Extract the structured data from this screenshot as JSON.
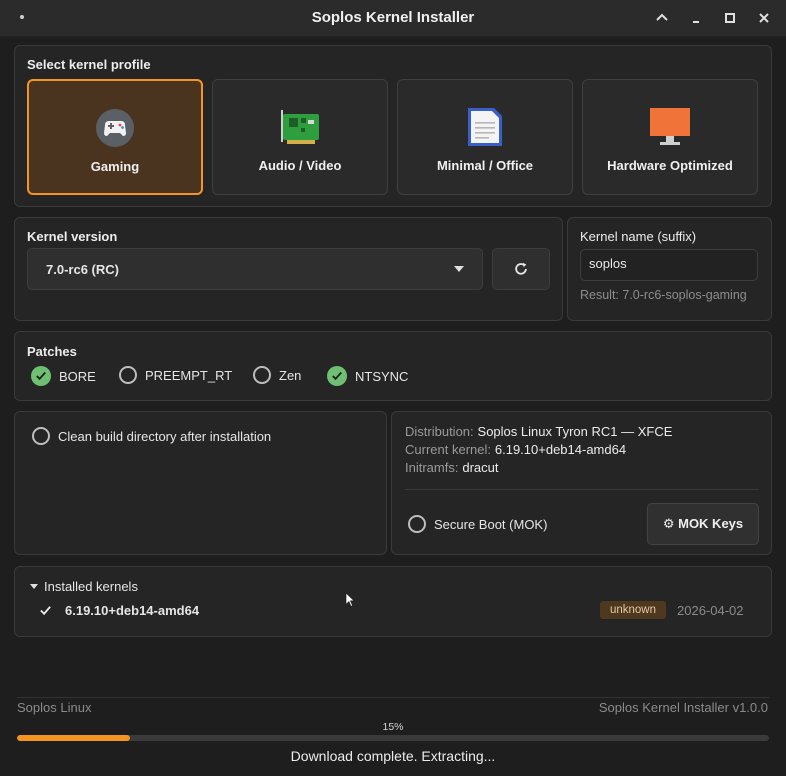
{
  "window": {
    "title": "Soplos Kernel Installer"
  },
  "profiles": {
    "title": "Select kernel profile",
    "items": [
      {
        "label": "Gaming",
        "icon": "gamepad-icon",
        "selected": true
      },
      {
        "label": "Audio / Video",
        "icon": "sound-card-icon",
        "selected": false
      },
      {
        "label": "Minimal / Office",
        "icon": "document-icon",
        "selected": false
      },
      {
        "label": "Hardware Optimized",
        "icon": "monitor-icon",
        "selected": false
      }
    ]
  },
  "kernel_version": {
    "title": "Kernel version",
    "selected": "7.0-rc6 (RC)"
  },
  "kernel_name": {
    "title": "Kernel name (suffix)",
    "value": "soplos",
    "result": "Result: 7.0-rc6-soplos-gaming"
  },
  "patches": {
    "title": "Patches",
    "items": [
      {
        "label": "BORE",
        "checked": true
      },
      {
        "label": "PREEMPT_RT",
        "checked": false
      },
      {
        "label": "Zen",
        "checked": false
      },
      {
        "label": "NTSYNC",
        "checked": true
      }
    ]
  },
  "options": {
    "clean_build_label": "Clean build directory after installation",
    "clean_build_checked": false
  },
  "system_info": {
    "distribution_label": "Distribution:",
    "distribution_value": "Soplos Linux Tyron RC1 — XFCE",
    "current_kernel_label": "Current kernel:",
    "current_kernel_value": "6.19.10+deb14-amd64",
    "initramfs_label": "Initramfs:",
    "initramfs_value": "dracut",
    "secure_boot_label": "Secure Boot (MOK)",
    "secure_boot_checked": false,
    "mok_button_label": "⚙ MOK Keys"
  },
  "installed": {
    "title": "Installed kernels",
    "items": [
      {
        "name": "6.19.10+deb14-amd64",
        "badge": "unknown",
        "date": "2026-04-02"
      }
    ]
  },
  "footer": {
    "left": "Soplos Linux",
    "right": "Soplos Kernel Installer v1.0.0"
  },
  "progress": {
    "percent_label": "15%",
    "value": 0.15,
    "status": "Download complete. Extracting..."
  },
  "colors": {
    "accent": "#f5941f",
    "check": "#6fbf73",
    "background": "#1e1e1e",
    "panel": "#252525"
  }
}
